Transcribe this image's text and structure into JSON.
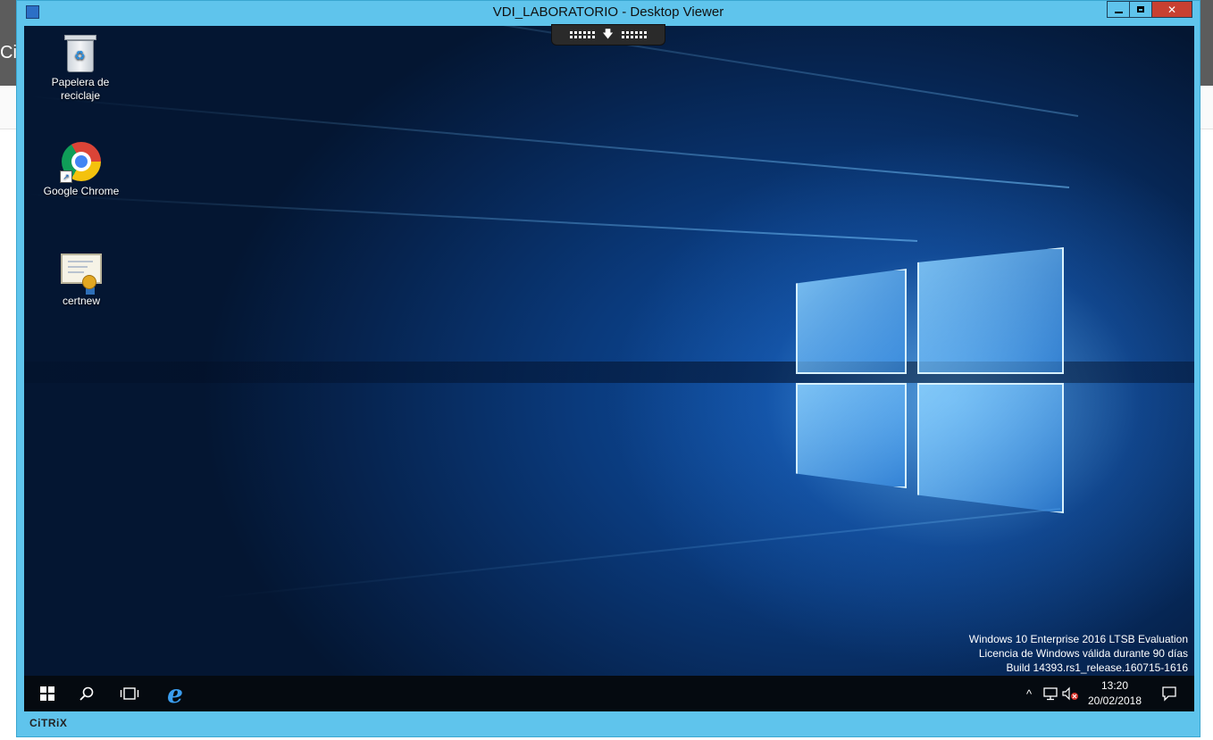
{
  "host": {
    "partial_text": "Ci"
  },
  "window": {
    "title": "VDI_LABORATORIO - Desktop Viewer",
    "buttons": {
      "minimize": "minimize-icon",
      "maximize": "maximize-icon",
      "close": "✕"
    }
  },
  "toolbar": {
    "center_glyph": "🡇"
  },
  "desktop_icons": [
    {
      "label": "Papelera de reciclaje",
      "icon": "recycle-bin-icon"
    },
    {
      "label": "Google Chrome",
      "icon": "chrome-icon"
    },
    {
      "label": "certnew",
      "icon": "certificate-icon"
    }
  ],
  "watermark": {
    "line1": "Windows 10 Enterprise 2016 LTSB Evaluation",
    "line2": "Licencia de Windows válida durante 90 días",
    "line3": "Build 14393.rs1_release.160715-1616"
  },
  "taskbar": {
    "pinned": [
      "windows-start-icon",
      "search-icon",
      "task-view-icon",
      "internet-explorer-icon"
    ],
    "ie_glyph": "e",
    "tray": {
      "chevron": "^",
      "time": "13:20",
      "date": "20/02/2018"
    }
  },
  "footer": {
    "brand": "CiTRiX"
  },
  "colors": {
    "frame": "#5fc4ec",
    "close": "#c84031",
    "desktop": "#0a3a7c",
    "taskbar": "#050a10"
  }
}
